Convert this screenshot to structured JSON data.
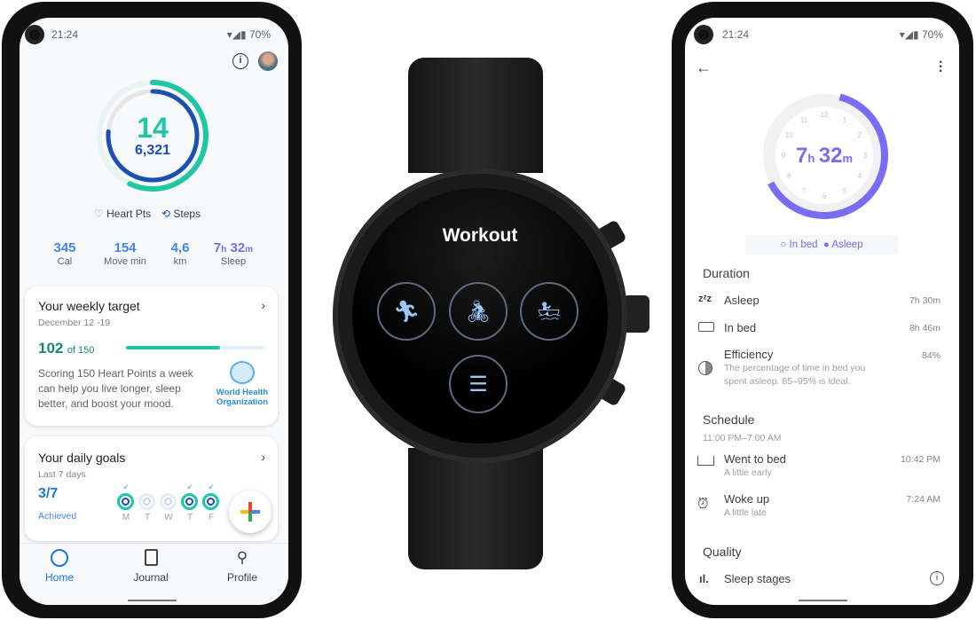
{
  "status": {
    "time": "21:24",
    "battery": "70%"
  },
  "home": {
    "heart_points": "14",
    "steps": "6,321",
    "heart_pts_label": "Heart Pts",
    "steps_label": "Steps",
    "stats": [
      {
        "value": "345",
        "label": "Cal"
      },
      {
        "value": "154",
        "label": "Move min"
      },
      {
        "value": "4,6",
        "label": "km"
      },
      {
        "value_h": "7",
        "unit_h": "h",
        "value_m": "32",
        "unit_m": "m",
        "label": "Sleep"
      }
    ],
    "weekly": {
      "title": "Your weekly target",
      "dates": "December 12 -19",
      "value": "102",
      "of": "of 150",
      "progress": 0.68,
      "text": "Scoring 150 Heart Points a week can help you live longer, sleep better, and boost your mood.",
      "who_line1": "World Health",
      "who_line2": "Organization"
    },
    "daily": {
      "title": "Your daily goals",
      "subtitle": "Last 7 days",
      "achieved": "3/7",
      "achieved_label": "Achieved",
      "days": [
        {
          "d": "M",
          "done": true
        },
        {
          "d": "T",
          "done": false
        },
        {
          "d": "W",
          "done": false
        },
        {
          "d": "T",
          "done": true
        },
        {
          "d": "F",
          "done": true
        }
      ]
    },
    "nav": [
      {
        "label": "Home",
        "icon": "home-ring-icon",
        "active": true
      },
      {
        "label": "Journal",
        "icon": "journal-icon"
      },
      {
        "label": "Profile",
        "icon": "profile-icon"
      }
    ],
    "colors": {
      "teal": "#1ec8a5",
      "blue": "#1a4fb4",
      "accent": "#4285f4",
      "purple": "#7b6cf6"
    }
  },
  "watch": {
    "title": "Workout",
    "buttons": [
      "run-icon",
      "bike-icon",
      "rowing-icon",
      "list-icon"
    ]
  },
  "sleep": {
    "total_h": "7",
    "unit_h": "h",
    "total_m": "32",
    "unit_m": "m",
    "clock_numbers": [
      "12",
      "1",
      "2",
      "3",
      "4",
      "5",
      "6",
      "7",
      "8",
      "9",
      "10",
      "11"
    ],
    "legend_inbed": "In bed",
    "legend_asleep": "Asleep",
    "duration_title": "Duration",
    "asleep": {
      "label": "Asleep",
      "value": "7h 30m"
    },
    "inbed": {
      "label": "In bed",
      "value": "8h 46m"
    },
    "efficiency": {
      "label": "Efficiency",
      "value": "84%",
      "desc1": "The percentage of time in bed you",
      "desc2": "spent asleep. 85–95% is ideal."
    },
    "schedule_title": "Schedule",
    "schedule_range": "11:00 PM–7:00 AM",
    "bed": {
      "label": "Went to bed",
      "sub": "A little early",
      "value": "10:42 PM"
    },
    "woke": {
      "label": "Woke up",
      "sub": "A little late",
      "value": "7:24 AM"
    },
    "quality_title": "Quality",
    "stages": "Sleep stages"
  }
}
